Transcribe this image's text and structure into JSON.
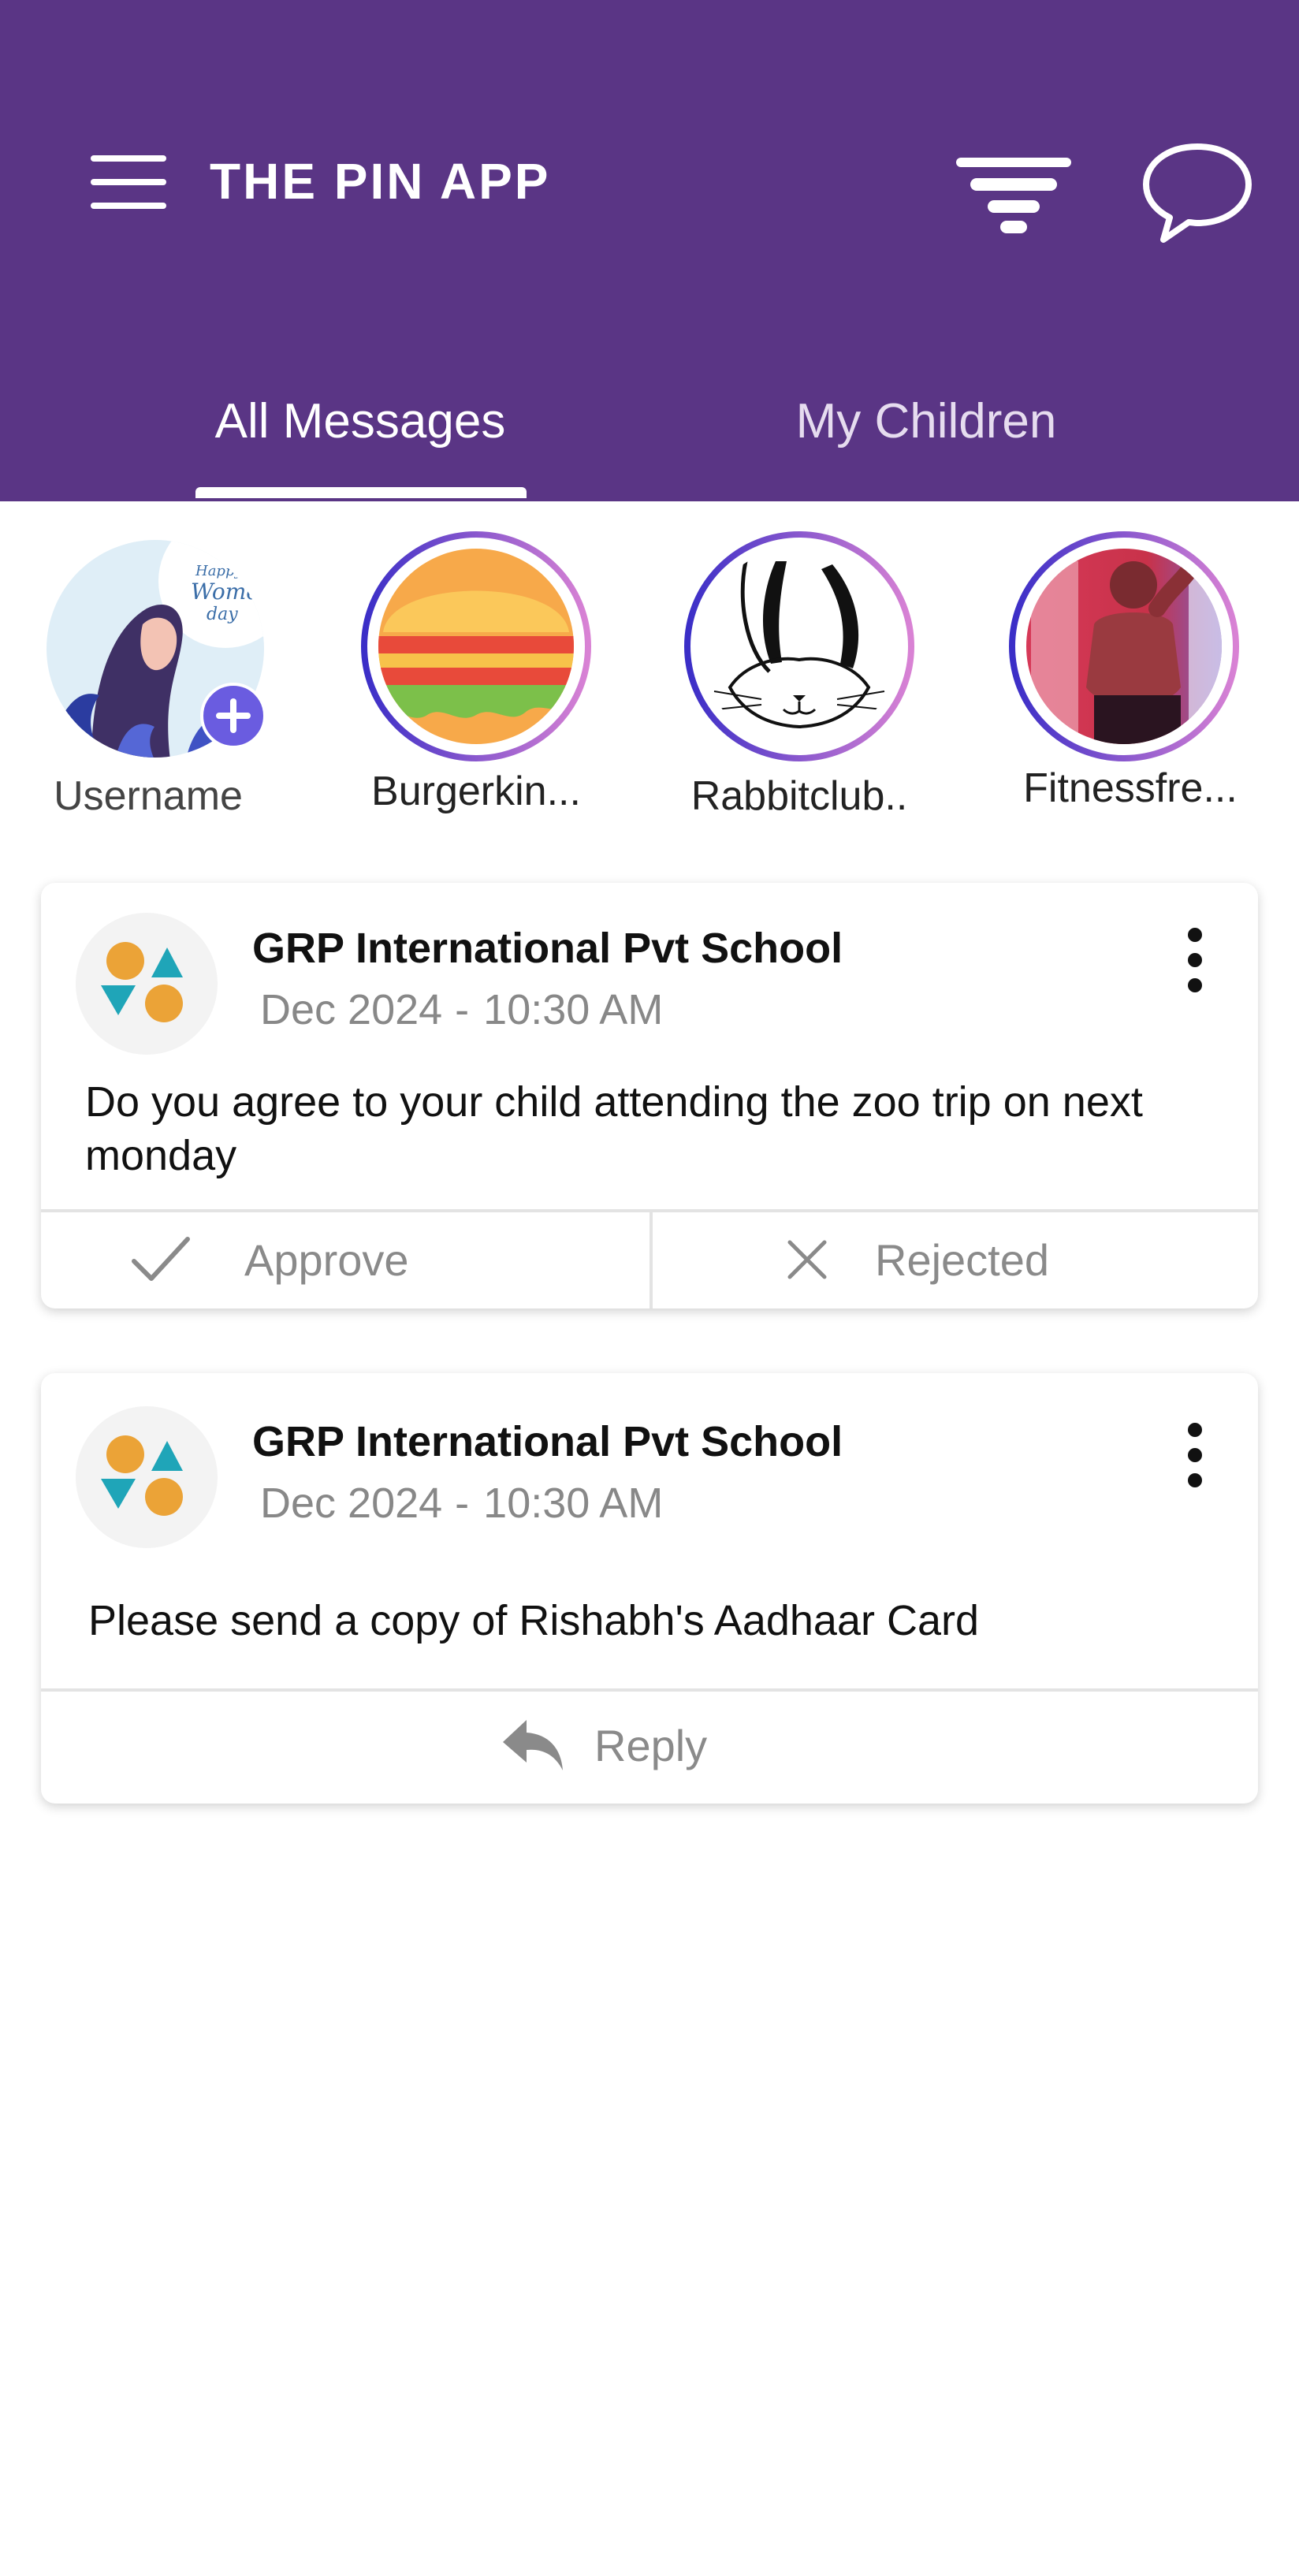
{
  "header": {
    "title": "THE PIN APP",
    "bg_color": "#5a3585",
    "icons": {
      "menu": "hamburger-menu-icon",
      "filter": "filter-icon",
      "chat": "chat-bubble-icon"
    }
  },
  "tabs": [
    {
      "label": "All Messages",
      "active": true
    },
    {
      "label": "My Children",
      "active": false
    }
  ],
  "stories": [
    {
      "label": "Username"
    },
    {
      "label": "Burgerkin..."
    },
    {
      "label": "Rabbitclub.."
    },
    {
      "label": "Fitnessfre..."
    }
  ],
  "messages": [
    {
      "sender": "GRP International Pvt School",
      "date": "Dec 2024",
      "time": "10:30 AM",
      "text": "Do you agree to your child attending the zoo trip on next monday",
      "actions": {
        "approve": "Approve",
        "reject": "Rejected"
      }
    },
    {
      "sender": "GRP International Pvt School",
      "date": "Dec 2024",
      "time": "10:30 AM",
      "text": "Please send a copy of Rishabh's Aadhaar Card",
      "actions": {
        "reply": "Reply"
      }
    }
  ],
  "colors": {
    "accent": "#5a3585",
    "ring_start": "#3a2ec7",
    "ring_end": "#d982d4",
    "logo_orange": "#eba337",
    "logo_teal": "#1fa5b8"
  }
}
